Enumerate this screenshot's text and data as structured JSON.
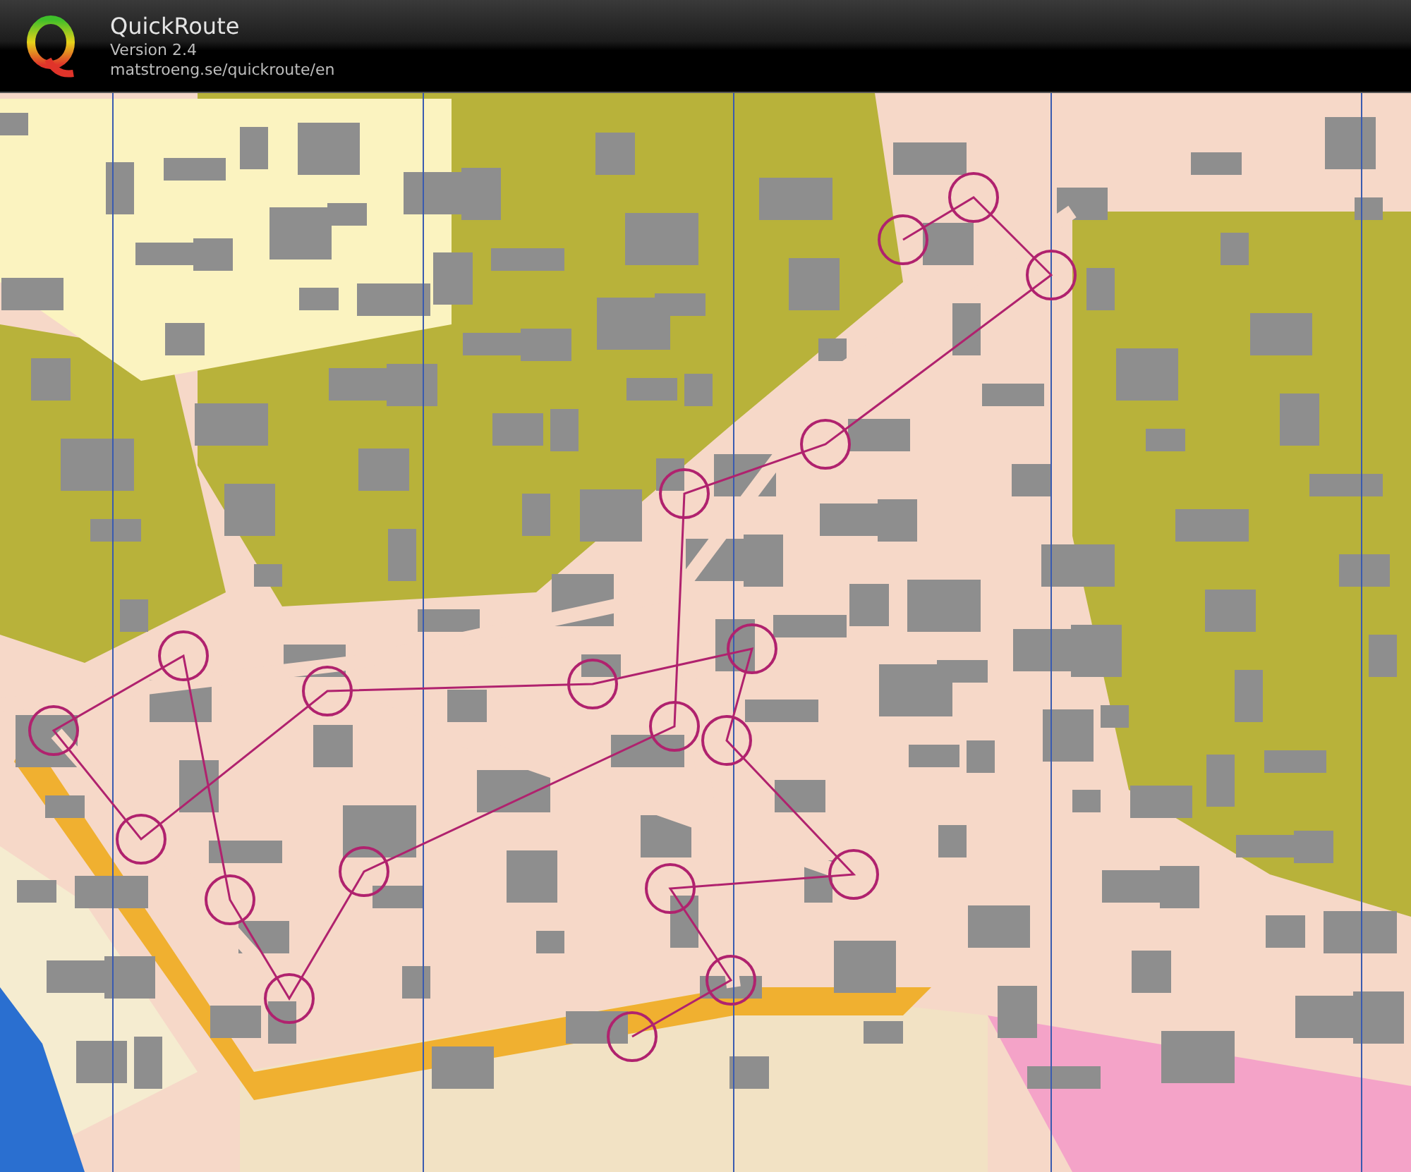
{
  "header": {
    "title": "QuickRoute",
    "version": "Version 2.4",
    "url": "matstroeng.se/quickroute/en"
  }
}
